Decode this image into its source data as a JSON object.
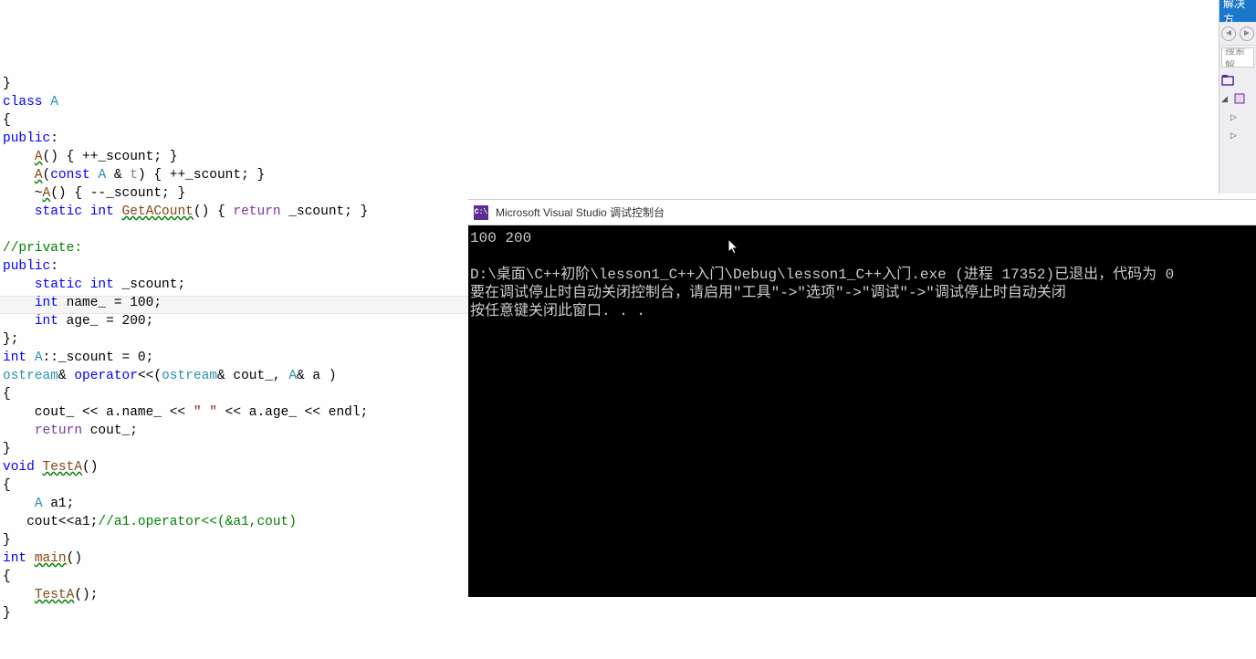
{
  "code": {
    "l1": "}",
    "l2_class": "class",
    "l2_A": " A",
    "l3": "{",
    "l4": "public",
    "l4_colon": ":",
    "l5_ind": "    ",
    "l5_A": "A",
    "l5_rest": "() { ++_scount; }",
    "l6_ind": "    ",
    "l6_A": "A",
    "l6_open": "(",
    "l6_const": "const",
    "l6_sp1": " ",
    "l6_Atype": "A",
    "l6_sp2": " & ",
    "l6_t": "t",
    "l6_rest": ") { ++_scount; }",
    "l7_ind": "    ~",
    "l7_A": "A",
    "l7_rest": "() { --_scount; }",
    "l8_ind": "    ",
    "l8_static": "static",
    "l8_sp1": " ",
    "l8_int": "int",
    "l8_sp2": " ",
    "l8_fn": "GetACount",
    "l8_rest1": "() { ",
    "l8_return": "return",
    "l8_rest2": " _scount; }",
    "l9": "",
    "l10": "//private:",
    "l11": "public",
    "l11_colon": ":",
    "l12_ind": "    ",
    "l12_static": "static",
    "l12_sp1": " ",
    "l12_int": "int",
    "l12_rest": " _scount;",
    "l13_ind": "    ",
    "l13_int": "int",
    "l13_rest": " name_ = 100;",
    "l14_ind": "    ",
    "l14_int": "int",
    "l14_rest": " age_ = 200;",
    "l15": "};",
    "l16_int": "int",
    "l16_sp": " ",
    "l16_A": "A",
    "l16_rest": "::_scount = 0;",
    "l17_os": "ostream",
    "l17_amp": "& ",
    "l17_op": "operator",
    "l17_lt": "<<(",
    "l17_os2": "ostream",
    "l17_rest": "& cout_, ",
    "l17_A": "A",
    "l17_rest2": "& a )",
    "l18": "{",
    "l19_ind": "    cout_ << a.name_ << ",
    "l19_str": "\" \"",
    "l19_rest": " << a.age_ << endl;",
    "l20_ind": "    ",
    "l20_return": "return",
    "l20_rest": " cout_;",
    "l21": "}",
    "l22_void": "void",
    "l22_sp": " ",
    "l22_fn": "TestA",
    "l22_rest": "()",
    "l23": "{",
    "l24_ind": "    ",
    "l24_A": "A",
    "l24_rest": " a1;",
    "l25_ind": "   cout<<a1;",
    "l25_comment": "//a1.operator<<(&a1,cout)",
    "l26": "}",
    "l27_int": "int",
    "l27_sp": " ",
    "l27_main": "main",
    "l27_rest": "()",
    "l28": "{",
    "l29_ind": "    ",
    "l29_fn": "TestA",
    "l29_rest": "();",
    "l30": "}"
  },
  "console": {
    "title": "Microsoft Visual Studio 调试控制台",
    "output": "100 200",
    "line2": "D:\\桌面\\C++初阶\\lesson1_C++入门\\Debug\\lesson1_C++入门.exe (进程 17352)已退出，代码为 0",
    "line3": "要在调试停止时自动关闭控制台，请启用\"工具\"->\"选项\"->\"调试\"->\"调试停止时自动关闭",
    "line4": "按任意键关闭此窗口. . ."
  },
  "sidebar": {
    "title": "解决方",
    "search_placeholder": "搜索解"
  }
}
